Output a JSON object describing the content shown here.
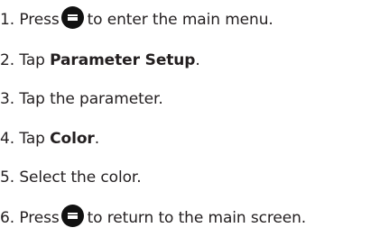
{
  "steps": [
    {
      "number": "1.",
      "before": "Press",
      "icon": "menu-key-icon",
      "after": "to enter the main menu."
    },
    {
      "number": "2.",
      "before": "Tap",
      "bold": "Parameter Setup",
      "after": "."
    },
    {
      "number": "3.",
      "text": "Tap the parameter."
    },
    {
      "number": "4.",
      "before": "Tap",
      "bold": "Color",
      "after": "."
    },
    {
      "number": "5.",
      "text": "Select the color."
    },
    {
      "number": "6.",
      "before": "Press",
      "icon": "menu-key-icon",
      "after": "to return to the main screen."
    }
  ]
}
